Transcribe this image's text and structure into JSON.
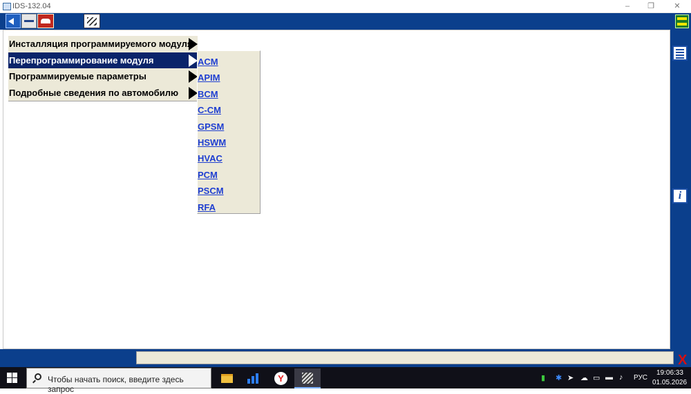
{
  "window": {
    "title": "IDS-132.04",
    "minimize": "–",
    "restore": "❐",
    "close": "✕"
  },
  "toolbar": {
    "icons": [
      "back-icon",
      "tool-icon",
      "car-icon",
      "document-icon",
      "swap-icon"
    ]
  },
  "menu": {
    "items": [
      {
        "label": "Инсталляция программируемого модуля",
        "selected": false
      },
      {
        "label": "Перепрограммирование модуля",
        "selected": true
      },
      {
        "label": "Программируемые параметры",
        "selected": false
      },
      {
        "label": "Подробные сведения по автомобилю",
        "selected": false
      }
    ]
  },
  "submenu": {
    "items": [
      "ACM",
      "APIM",
      "BCM",
      "C-CM",
      "GPSM",
      "HSWM",
      "HVAC",
      "PCM",
      "PSCM",
      "RFA"
    ]
  },
  "sidebar": {
    "list_icon": "list-icon",
    "info_label": "i"
  },
  "statusbar": {
    "status_text": "",
    "close_label": "X"
  },
  "taskbar": {
    "search_placeholder": "Чтобы начать поиск, введите здесь запрос",
    "yandex_label": "Y",
    "language": "РУС",
    "time": "19:06:33",
    "date": "01.05.2026"
  },
  "colors": {
    "toolbar_bg": "#0b3f8c",
    "selection_bg": "#0a246a",
    "menu_bg": "#ece9d8",
    "link": "#1f3fd1"
  }
}
